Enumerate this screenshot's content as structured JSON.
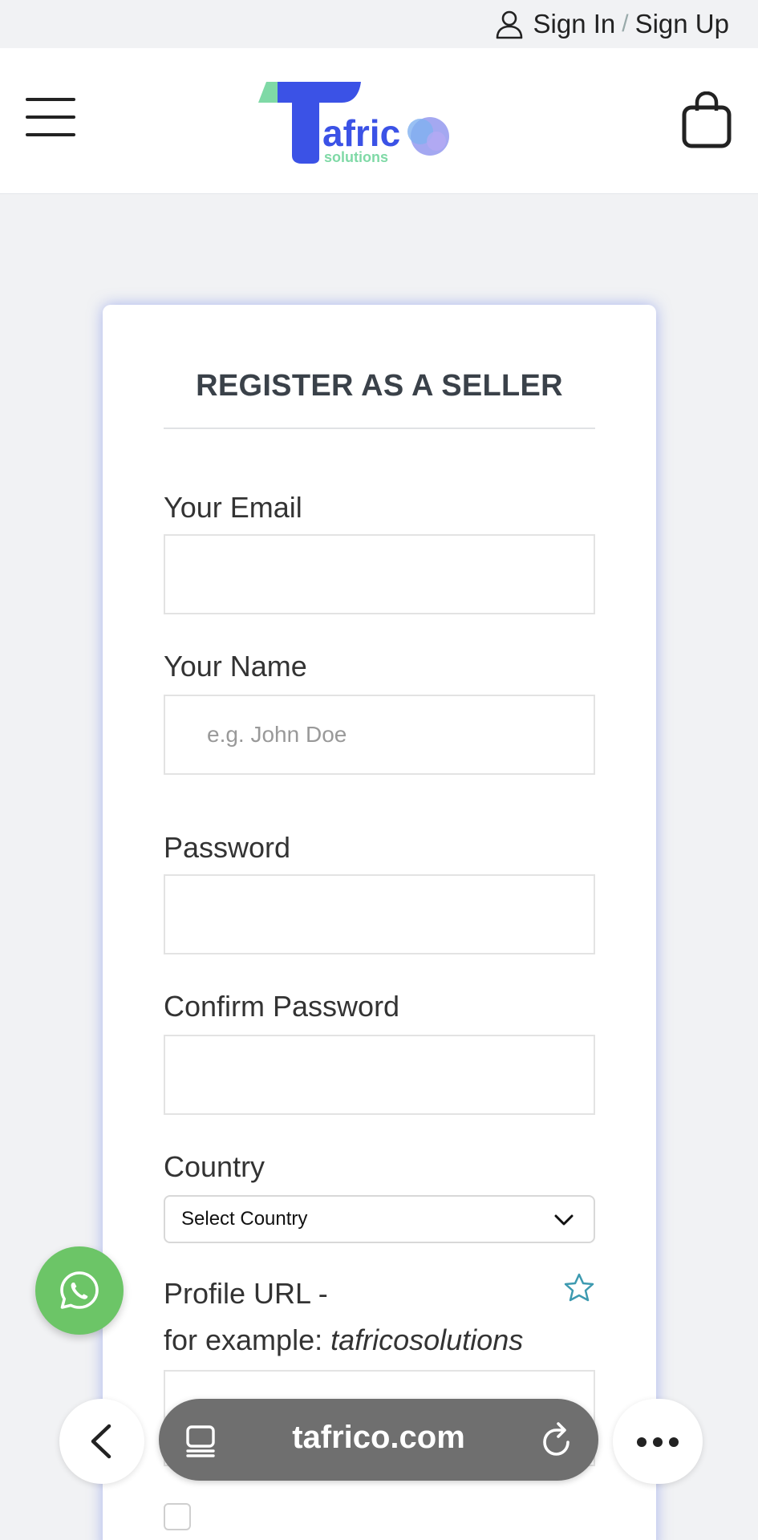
{
  "topbar": {
    "sign_in": "Sign In",
    "separator": "/",
    "sign_up": "Sign Up",
    "user_icon": "user-icon"
  },
  "header": {
    "menu_icon": "hamburger-menu-icon",
    "logo": {
      "main": "afric",
      "sub": "solutions"
    },
    "cart_icon": "shopping-bag-icon"
  },
  "form": {
    "title": "REGISTER AS A SELLER",
    "email": {
      "label": "Your Email",
      "value": ""
    },
    "name": {
      "label": "Your Name",
      "placeholder": "e.g. John Doe"
    },
    "password": {
      "label": "Password",
      "value": ""
    },
    "confirm_password": {
      "label": "Confirm Password",
      "value": ""
    },
    "country": {
      "label": "Country",
      "selected": "Select Country"
    },
    "profile_url": {
      "label": "Profile URL -",
      "example_prefix": "for example:",
      "example_value": "tafricosolutions"
    }
  },
  "browser": {
    "url": "tafrico.com",
    "back_icon": "chevron-left-icon",
    "tabs_icon": "tabs-icon",
    "reload_icon": "reload-icon",
    "more_icon": "more-dots-icon"
  },
  "colors": {
    "whatsapp": "#6cc567",
    "logo_blue": "#3b52e6",
    "logo_green": "#7fd9a6",
    "card_glow": "#6e82e6",
    "star": "#3d9ab0"
  }
}
